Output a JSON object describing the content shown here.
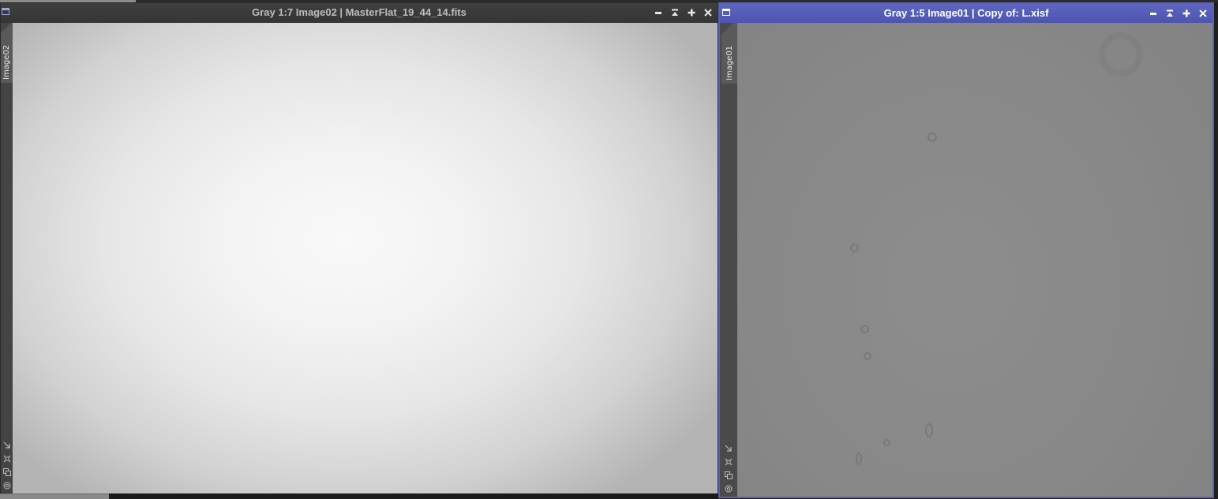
{
  "windows": {
    "left": {
      "title": "Gray 1:7 Image02 | MasterFlat_19_44_14.fits",
      "view_tab": "Image02",
      "active": false
    },
    "right": {
      "title": "Gray 1:5 Image01 | Copy of: L.xisf",
      "view_tab": "Image01",
      "active": true,
      "accent_color": "#5a63b8"
    }
  },
  "title_buttons": [
    "minimize-icon",
    "shade-icon",
    "maximize-icon",
    "close-icon"
  ],
  "side_tools": [
    "fit-arrow-icon",
    "zoom-fit-icon",
    "clone-icon",
    "target-icon"
  ],
  "colors": {
    "active_title_bar": "#5a63b8",
    "inactive_title_bar": "#3c3c3c",
    "flat_frame_center": "#f9f9f9",
    "flat_frame_edge": "#b4b4b4",
    "light_frame": "#888888"
  }
}
